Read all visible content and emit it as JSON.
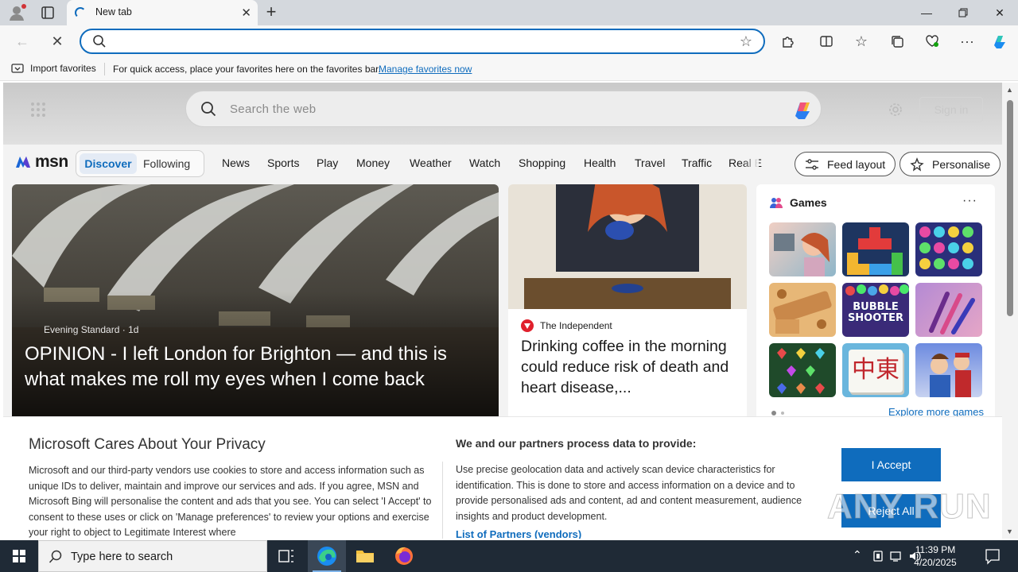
{
  "browser": {
    "tab_title": "New tab",
    "address_value": "",
    "favorites_bar": {
      "import_label": "Import favorites",
      "hint": "For quick access, place your favorites here on the favorites bar.",
      "manage_link": "Manage favorites now"
    }
  },
  "msn": {
    "search_placeholder": "Search the web",
    "sign_in": "Sign in",
    "logo_text": "msn",
    "pill_tabs": [
      "Discover",
      "Following"
    ],
    "categories": [
      "News",
      "Sports",
      "Play",
      "Money",
      "Weather",
      "Watch",
      "Shopping",
      "Health",
      "Travel",
      "Traffic",
      "Real E"
    ],
    "feed_layout": "Feed layout",
    "personalise": "Personalise"
  },
  "hero": {
    "source": "Evening Standard",
    "age": "1d",
    "headline": "OPINION - I left London for Brighton — and this is what makes me roll my eyes when I come back"
  },
  "article2": {
    "source": "The Independent",
    "title": "Drinking coffee in the morning could reduce risk of death and heart disease,..."
  },
  "games": {
    "title": "Games",
    "explore": "Explore more games",
    "tiles": [
      "game-tile-hospital",
      "game-tile-blocks",
      "game-tile-jewels",
      "game-tile-wood",
      "game-tile-bubble-shooter",
      "game-tile-makeup",
      "game-tile-gems",
      "game-tile-mahjong",
      "game-tile-hotel"
    ],
    "bubble_text": "BUBBLE SHOOTER",
    "mahjong_text": "中東"
  },
  "privacy": {
    "title": "Microsoft Cares About Your Privacy",
    "body": "Microsoft and our third-party vendors use cookies to store and access information such as unique IDs to deliver, maintain and improve our services and ads. If you agree, MSN and Microsoft Bing will personalise the content and ads that you see. You can select 'I Accept' to consent to these uses or click on 'Manage preferences' to review your options and exercise your right to object to Legitimate Interest where",
    "subtitle": "We and our partners process data to provide:",
    "body2": "Use precise geolocation data and actively scan device characteristics for identification. This is done to store and access information on a device and to provide personalised ads and content, ad and content measurement, audience insights and product development.",
    "partners_link": "List of Partners (vendors)",
    "accept": "I Accept",
    "reject": "Reject All",
    "watermark": "ANY RUN"
  },
  "taskbar": {
    "search_text": "Type here to search",
    "time": "11:39 PM",
    "date": "4/20/2025"
  },
  "colors": {
    "accent": "#0f6cbd",
    "taskbar": "#1f2a36"
  }
}
